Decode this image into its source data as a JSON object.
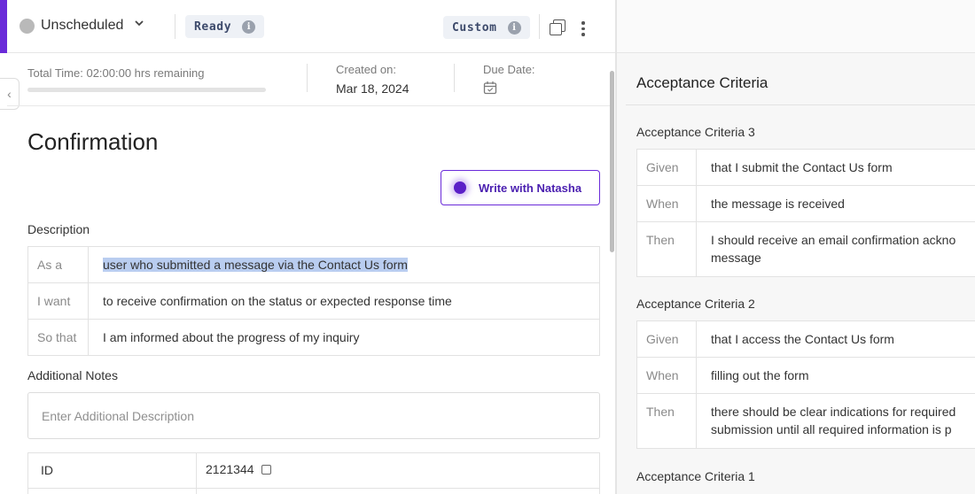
{
  "toolbar": {
    "status": "Unscheduled",
    "ready_label": "Ready",
    "custom_label": "Custom"
  },
  "meta": {
    "total_time": "Total Time: 02:00:00 hrs remaining",
    "time_progress": 0,
    "created_label": "Created on:",
    "created_value": "Mar 18, 2024",
    "due_label": "Due Date:"
  },
  "story": {
    "title": "Confirmation",
    "write_button": "Write with Natasha",
    "description_label": "Description",
    "description_rows": [
      {
        "key": "As a",
        "value": "user who submitted a message via the Contact Us form"
      },
      {
        "key": "I want",
        "value": "to receive confirmation on the status or expected response time"
      },
      {
        "key": "So that",
        "value": "I am informed about the progress of my inquiry"
      }
    ],
    "notes_label": "Additional Notes",
    "notes_placeholder": "Enter Additional Description",
    "id_label": "ID",
    "id_value": "2121344"
  },
  "acceptance": {
    "title": "Acceptance Criteria",
    "criteria": [
      {
        "label": "Acceptance Criteria 3",
        "rows": [
          {
            "key": "Given",
            "value": "that I submit the Contact Us form"
          },
          {
            "key": "When",
            "value": "the message is received"
          },
          {
            "key": "Then",
            "value": "I should receive an email confirmation ackno",
            "value2": "message"
          }
        ]
      },
      {
        "label": "Acceptance Criteria 2",
        "rows": [
          {
            "key": "Given",
            "value": "that I access the Contact Us form"
          },
          {
            "key": "When",
            "value": "filling out the form"
          },
          {
            "key": "Then",
            "value": "there should be clear indications for required",
            "value2": "submission until all required information is p"
          }
        ]
      },
      {
        "label": "Acceptance Criteria 1"
      }
    ]
  },
  "colors": {
    "accent": "#6a2bd9",
    "pill_bg": "#eef1f6",
    "highlight": "#b9cdf0"
  },
  "icons": [
    "status-dot-icon",
    "chevron-down-icon",
    "info-icon",
    "copy-icon",
    "more-vertical-icon",
    "calendar-icon",
    "collapse-left-icon",
    "ai-orb-icon"
  ]
}
